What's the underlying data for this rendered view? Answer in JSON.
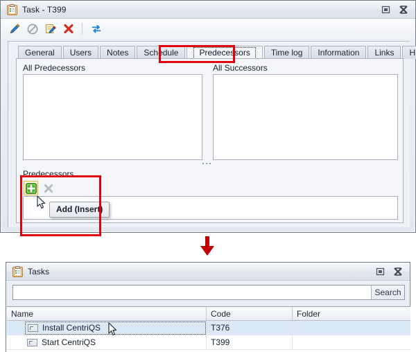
{
  "task_window": {
    "title": "Task - T399",
    "icon": "clipboard-icon",
    "restore_label": "Restore",
    "close_label": "Close",
    "toolbar": [
      {
        "name": "edit-icon",
        "label": "Edit"
      },
      {
        "name": "cancel-icon",
        "label": "Cancel"
      },
      {
        "name": "edit-note-icon",
        "label": "Edit note"
      },
      {
        "name": "delete-icon",
        "label": "Delete"
      },
      {
        "name": "refresh-icon",
        "label": "Refresh"
      }
    ],
    "tabs": [
      {
        "label": "General",
        "selected": false
      },
      {
        "label": "Users",
        "selected": false
      },
      {
        "label": "Notes",
        "selected": false
      },
      {
        "label": "Schedule",
        "selected": false
      },
      {
        "label": "Predecessors",
        "selected": true
      },
      {
        "label": "Time log",
        "selected": false
      },
      {
        "label": "Information",
        "selected": false
      },
      {
        "label": "Links",
        "selected": false
      },
      {
        "label": "History",
        "selected": false
      }
    ],
    "panes": {
      "all_predecessors_label": "All Predecessors",
      "all_successors_label": "All Successors",
      "predecessors_label": "Predecessors"
    },
    "predecessor_buttons": [
      {
        "name": "add-icon",
        "label": "Add",
        "state": "hover"
      },
      {
        "name": "remove-icon",
        "label": "Remove",
        "state": "disabled"
      }
    ],
    "tooltip": "Add (Insert)"
  },
  "flow": {
    "arrow": "down-arrow",
    "arrow_color": "#c00000"
  },
  "tasks_window": {
    "title": "Tasks",
    "icon": "clipboard-icon",
    "restore_label": "Restore",
    "close_label": "Close",
    "search": {
      "value": "",
      "placeholder": "",
      "button_label": "Search"
    },
    "grid": {
      "columns": [
        "Name",
        "Code",
        "Folder"
      ],
      "rows": [
        {
          "name": "Install CentriQS",
          "code": "T376",
          "folder": "",
          "selected": true
        },
        {
          "name": "Start CentriQS",
          "code": "T399",
          "folder": "",
          "selected": false
        }
      ]
    }
  },
  "highlights": {
    "tab_highlight_color": "#e2000f",
    "predecessors_highlight_color": "#e2000f"
  }
}
